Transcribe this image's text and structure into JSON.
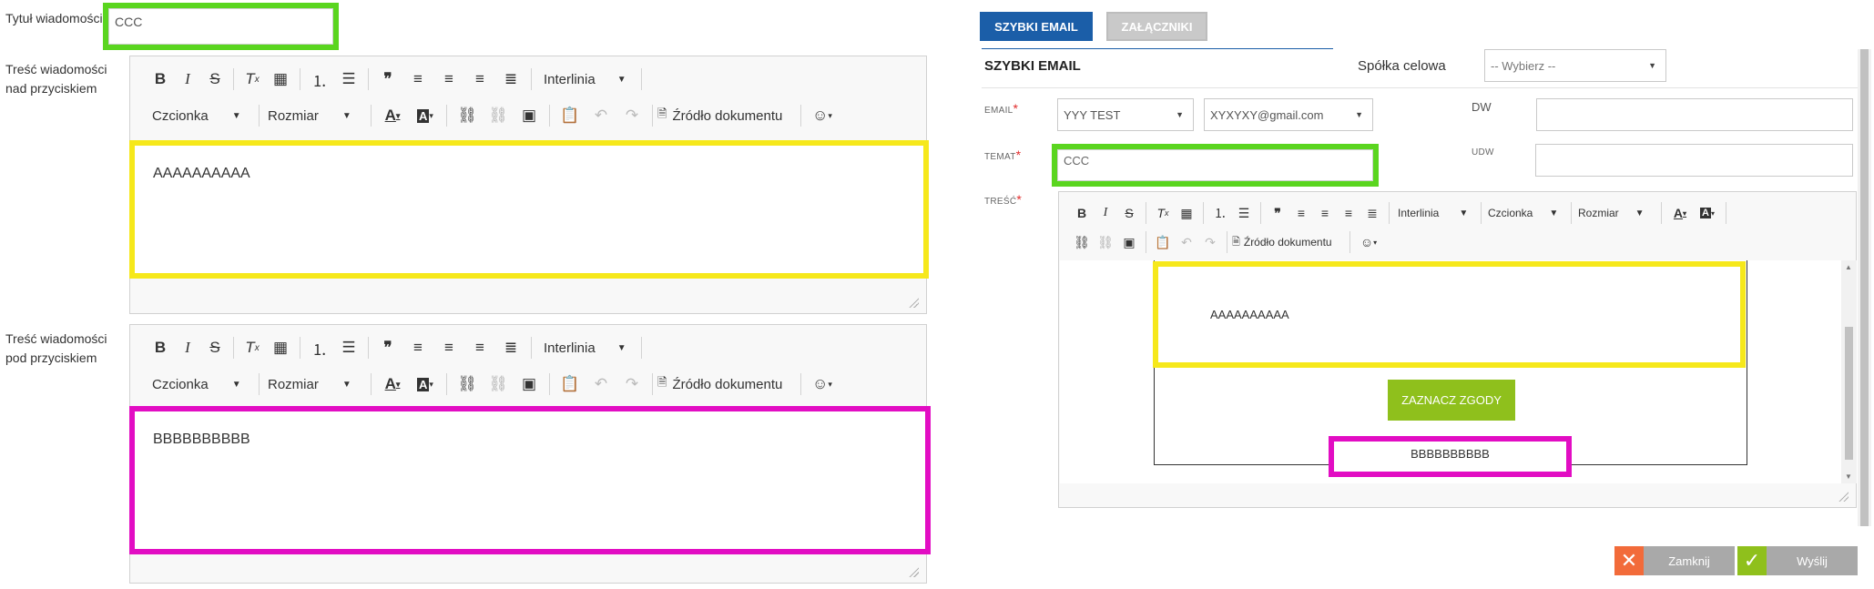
{
  "left": {
    "title_label": "Tytuł wiadomości",
    "title_value": "CCC",
    "above_label_line1": "Treść wiadomości",
    "above_label_line2": "nad przyciskiem",
    "below_label_line1": "Treść wiadomości",
    "below_label_line2": "pod przyciskiem",
    "toolbar": {
      "line_spacing": "Interlinia",
      "font": "Czcionka",
      "size": "Rozmiar",
      "source": "Źródło dokumentu"
    },
    "editor_above_text": "AAAAAAAAAA",
    "editor_below_text": "BBBBBBBBBB"
  },
  "right": {
    "tabs": [
      {
        "label": "SZYBKI EMAIL",
        "active": true
      },
      {
        "label": "ZAŁĄCZNIKI",
        "active": false
      }
    ],
    "section_title": "SZYBKI EMAIL",
    "company_label": "Spółka celowa",
    "company_select": "-- Wybierz --",
    "email_label": "EMAIL",
    "email_select": "YYY TEST",
    "email_address": "XYXYXY@gmail.com",
    "dw_label": "DW",
    "udw_label": "UDW",
    "subject_label": "TEMAT",
    "subject_value": "CCC",
    "body_label": "TREŚĆ",
    "required_mark": "*",
    "toolbar": {
      "line_spacing": "Interlinia",
      "font": "Czcionka",
      "size": "Rozmiar",
      "source": "Źródło dokumentu"
    },
    "preview_above_text": "AAAAAAAAAA",
    "preview_button": "ZAZNACZ ZGODY",
    "preview_below_text": "BBBBBBBBBB",
    "close_button": "Zamknij",
    "send_button": "Wyślij"
  },
  "colors": {
    "highlight_green": "#5ad51f",
    "highlight_yellow": "#f6e81b",
    "highlight_magenta": "#e20dc3",
    "tab_active": "#1b5ea8",
    "consent_button": "#8fc01c",
    "close_icon": "#f26b3a",
    "send_icon": "#8fc01c"
  }
}
